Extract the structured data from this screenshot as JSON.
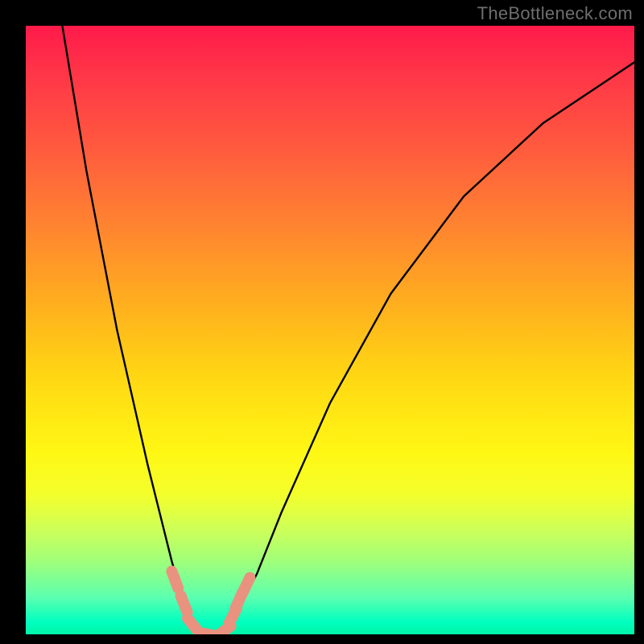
{
  "attribution": "TheBottleneck.com",
  "chart_data": {
    "type": "line",
    "title": "",
    "xlabel": "",
    "ylabel": "",
    "xlim": [
      0,
      100
    ],
    "ylim": [
      0,
      100
    ],
    "background_gradient_meaning": "red (top) = high bottleneck, green (bottom) = no bottleneck",
    "series": [
      {
        "name": "bottleneck-curve",
        "x": [
          6,
          10,
          15,
          20,
          24,
          26,
          28,
          29.5,
          31,
          33,
          35,
          38,
          42,
          50,
          60,
          72,
          85,
          100
        ],
        "values": [
          100,
          76,
          50,
          28,
          12,
          5,
          1,
          0,
          0,
          1,
          4,
          10,
          20,
          38,
          56,
          72,
          84,
          94
        ]
      }
    ],
    "markers": {
      "name": "highlighted-points",
      "color": "#e9927f",
      "points": [
        {
          "x": 24.5,
          "y": 9
        },
        {
          "x": 26.0,
          "y": 5
        },
        {
          "x": 27.5,
          "y": 1.5
        },
        {
          "x": 30.0,
          "y": 0
        },
        {
          "x": 32.5,
          "y": 0.5
        },
        {
          "x": 34.0,
          "y": 3
        },
        {
          "x": 35.0,
          "y": 5.5
        },
        {
          "x": 36.2,
          "y": 8
        }
      ]
    }
  }
}
